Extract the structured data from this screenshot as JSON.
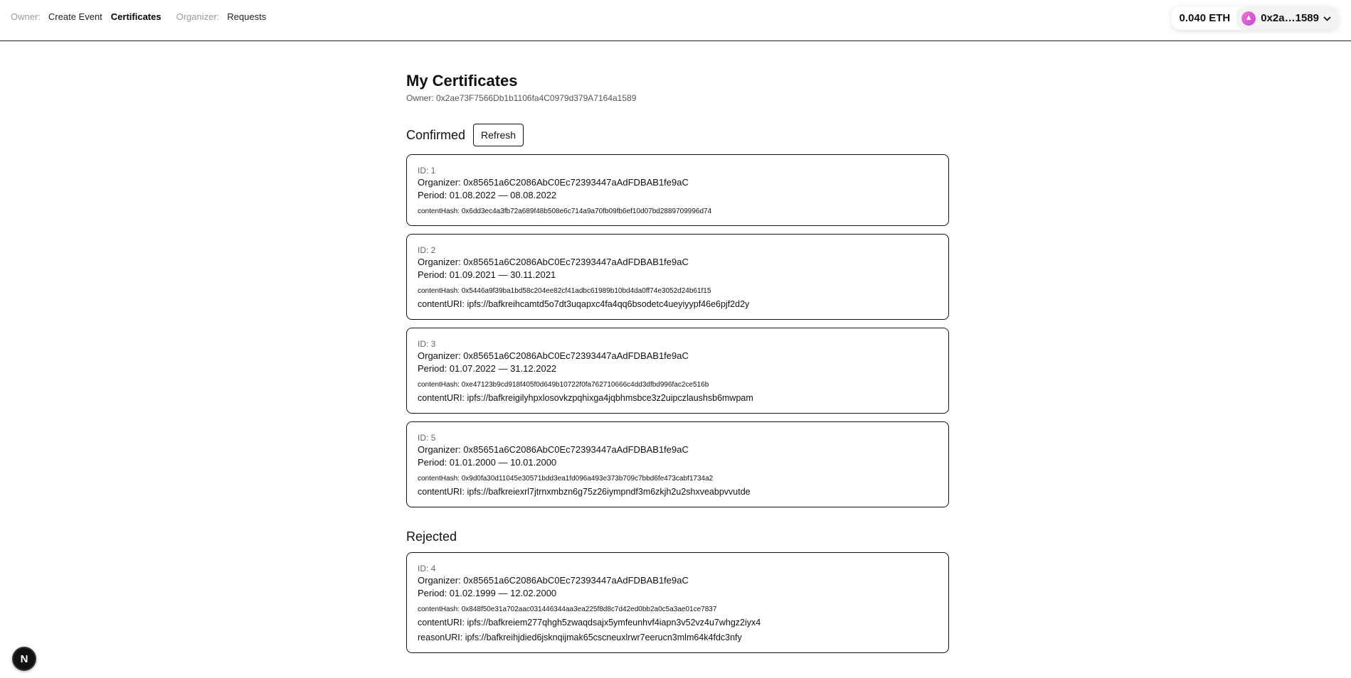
{
  "header": {
    "owner_label": "Owner:",
    "create_event": "Create Event",
    "certificates": "Certificates",
    "organizer_label": "Organizer:",
    "requests": "Requests"
  },
  "wallet": {
    "balance": "0.040 ETH",
    "account": "0x2a…1589",
    "avatar_glyph": "▲"
  },
  "page": {
    "title": "My Certificates",
    "owner_line": "Owner: 0x2ae73F7566Db1b1106fa4C0979d379A7164a1589"
  },
  "confirmed": {
    "title": "Confirmed",
    "refresh_label": "Refresh",
    "items": [
      {
        "id": "ID: 1",
        "organizer": "Organizer: 0x85651a6C2086AbC0Ec72393447aAdFDBAB1fe9aC",
        "period": "Period: 01.08.2022 — 08.08.2022",
        "hash": "contentHash: 0x6dd3ec4a3fb72a689f48b508e6c714a9a70fb09fb6ef10d07bd2889709996d74"
      },
      {
        "id": "ID: 2",
        "organizer": "Organizer: 0x85651a6C2086AbC0Ec72393447aAdFDBAB1fe9aC",
        "period": "Period: 01.09.2021 — 30.11.2021",
        "hash": "contentHash: 0x5446a9f39ba1bd58c204ee82cf41adbc61989b10bd4da0ff74e3052d24b61f15",
        "uri": "contentURI: ipfs://bafkreihcamtd5o7dt3uqapxc4fa4qq6bsodetc4ueyiyypf46e6pjf2d2y"
      },
      {
        "id": "ID: 3",
        "organizer": "Organizer: 0x85651a6C2086AbC0Ec72393447aAdFDBAB1fe9aC",
        "period": "Period: 01.07.2022 — 31.12.2022",
        "hash": "contentHash: 0xe47123b9cd918f405f0d649b10722f0fa762710666c4dd3dfbd996fac2ce516b",
        "uri": "contentURI: ipfs://bafkreigilyhpxlosovkzpqhixga4jqbhmsbce3z2uipczlaushsb6mwpam"
      },
      {
        "id": "ID: 5",
        "organizer": "Organizer: 0x85651a6C2086AbC0Ec72393447aAdFDBAB1fe9aC",
        "period": "Period: 01.01.2000 — 10.01.2000",
        "hash": "contentHash: 0x9d0fa30d11045e30571bdd3ea1fd096a493e373b709c7bbd6fe473cabf1734a2",
        "uri": "contentURI: ipfs://bafkreiexrl7jtrnxmbzn6g75z26iympndf3m6zkjh2u2shxveabpvvutde"
      }
    ]
  },
  "rejected": {
    "title": "Rejected",
    "items": [
      {
        "id": "ID: 4",
        "organizer": "Organizer: 0x85651a6C2086AbC0Ec72393447aAdFDBAB1fe9aC",
        "period": "Period: 01.02.1999 — 12.02.2000",
        "hash": "contentHash: 0x848f50e31a702aac031446344aa3ea225f8d8c7d42ed0bb2a0c5a3ae01ce7837",
        "uri": "contentURI: ipfs://bafkreiem277qhgh5zwaqdsajx5ymfeunhvf4iapn3v52vz4u7whgz2iyx4",
        "reason": "reasonURI: ipfs://bafkreihjdied6jsknqijmak65cscneuxlrwr7eerucn3mlm64k4fdc3nfy"
      }
    ]
  },
  "badge": {
    "glyph": "N"
  }
}
